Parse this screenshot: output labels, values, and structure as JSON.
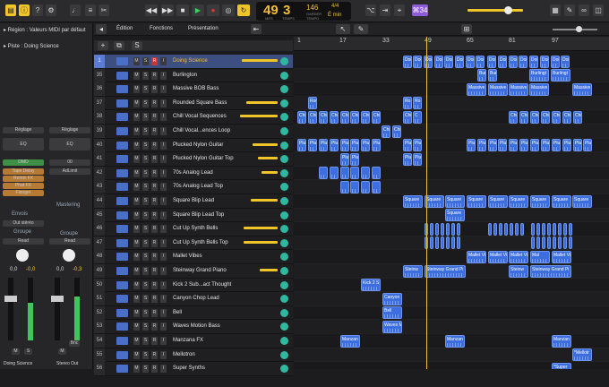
{
  "transport": {
    "bar": "49",
    "beat": "3",
    "bar_lbl": "MES",
    "beat_lbl": "TEMPS",
    "tempo": "146",
    "tempo_lbl": "GARDER",
    "tempo_lbl2": "TEMPO",
    "sig": "4/4",
    "key": "É min",
    "cpu_badge": "⌘34"
  },
  "menus": {
    "edit": "Édition",
    "functions": "Fonctions",
    "presentation": "Présentation"
  },
  "inspector": {
    "region_label": "▸ Région : Valeurs MIDI par défaut",
    "track_label": "▸ Piste : Doing Science",
    "left": {
      "setting": "Réglage",
      "eq": "EQ",
      "midi": "DMD",
      "plugins": [
        "Tape Delay",
        "Remix FX",
        "Phat FX",
        "Flanger"
      ],
      "sends_label": "Envois",
      "send": "Out stéréo",
      "group_label": "Groupe",
      "read": "Read",
      "pan": "0,0",
      "vol": "-0,0",
      "m": "M",
      "s": "S",
      "name": "Doing Science"
    },
    "right": {
      "setting": "Réglage",
      "eq": "EQ",
      "input": "00",
      "limit": "AdLimit",
      "master_label": "Mastering",
      "group_label": "Groupe",
      "read": "Read",
      "pan": "0,0",
      "vol": "-0,3",
      "m": "M",
      "bnc": "Bnc",
      "name": "Stereo Out"
    }
  },
  "ruler": [
    "1",
    "17",
    "33",
    "49",
    "65",
    "81",
    "97"
  ],
  "tracks": [
    {
      "n": "1",
      "name": "Doing Science",
      "fader": 40
    },
    {
      "n": "35",
      "name": "Burlington",
      "fader": 0
    },
    {
      "n": "36",
      "name": "Massive BOB Bass",
      "fader": 0
    },
    {
      "n": "37",
      "name": "Rounded Square Bass",
      "fader": 35
    },
    {
      "n": "38",
      "name": "Chill Vocal Sequences",
      "fader": 42
    },
    {
      "n": "39",
      "name": "Chill Vocal...ences Loop",
      "fader": 0
    },
    {
      "n": "40",
      "name": "Plucked Nylon Guitar",
      "fader": 28
    },
    {
      "n": "41",
      "name": "Plucked Nylon Guitar Top",
      "fader": 22
    },
    {
      "n": "42",
      "name": "70s Analog Lead",
      "fader": 18
    },
    {
      "n": "43",
      "name": "70s Analog Lead Top",
      "fader": 0
    },
    {
      "n": "44",
      "name": "Square Blip Lead",
      "fader": 30
    },
    {
      "n": "45",
      "name": "Square Blip Lead Top",
      "fader": 0
    },
    {
      "n": "46",
      "name": "Cut Up Synth Bells",
      "fader": 38
    },
    {
      "n": "47",
      "name": "Cut Up Synth Bells Top",
      "fader": 38
    },
    {
      "n": "48",
      "name": "Mallet Vibes",
      "fader": 0
    },
    {
      "n": "49",
      "name": "Steinway Grand Piano",
      "fader": 20
    },
    {
      "n": "50",
      "name": "Kick 2 Sub...act Thought",
      "fader": 0
    },
    {
      "n": "51",
      "name": "Canyon Chop Lead",
      "fader": 0
    },
    {
      "n": "52",
      "name": "Bell",
      "fader": 0
    },
    {
      "n": "53",
      "name": "Waves Motion Bass",
      "fader": 0
    },
    {
      "n": "54",
      "name": "Manzana FX",
      "fader": 0
    },
    {
      "n": "55",
      "name": "Mellotron",
      "fader": 0
    },
    {
      "n": "56",
      "name": "Super Synths",
      "fader": 0
    }
  ],
  "regions": [
    {
      "t": 0,
      "x": [
        [
          122,
          10,
          "Doi"
        ],
        [
          133,
          10,
          "Doi"
        ],
        [
          145,
          10,
          "Doi"
        ],
        [
          157,
          10,
          "Doi"
        ],
        [
          168,
          10,
          "Doi"
        ],
        [
          180,
          10,
          "Doi"
        ],
        [
          192,
          10,
          "Doi"
        ],
        [
          203,
          10,
          "Doi"
        ],
        [
          216,
          10,
          "Doi"
        ],
        [
          228,
          10,
          "Doi"
        ],
        [
          240,
          10,
          "Doi"
        ],
        [
          251,
          10,
          "Doi"
        ],
        [
          263,
          10,
          "Doi"
        ],
        [
          275,
          10,
          "Doi"
        ],
        [
          287,
          10,
          "Doi"
        ],
        [
          298,
          10,
          "Doi"
        ]
      ]
    },
    {
      "t": 1,
      "x": [
        [
          205,
          10,
          "Bur"
        ],
        [
          217,
          10,
          "Bur"
        ],
        [
          263,
          22,
          "Burlingt"
        ],
        [
          287,
          22,
          "Burlingt"
        ]
      ]
    },
    {
      "t": 2,
      "x": [
        [
          193,
          22,
          "Massive"
        ],
        [
          217,
          22,
          "Massive"
        ],
        [
          240,
          22,
          "Massive"
        ],
        [
          263,
          22,
          "Massive"
        ],
        [
          311,
          22,
          "Massive"
        ]
      ]
    },
    {
      "t": 3,
      "x": [
        [
          16,
          10,
          "Rou"
        ],
        [
          122,
          10,
          "Ro"
        ],
        [
          133,
          10,
          "Ro"
        ]
      ]
    },
    {
      "t": 4,
      "x": [
        [
          4,
          10,
          "Chi"
        ],
        [
          16,
          10,
          "Chi"
        ],
        [
          28,
          10,
          "Chi"
        ],
        [
          40,
          10,
          "Chi"
        ],
        [
          52,
          10,
          "Chi"
        ],
        [
          63,
          10,
          "Chi"
        ],
        [
          75,
          10,
          "Chi"
        ],
        [
          87,
          10,
          "Chi"
        ],
        [
          122,
          10,
          "Chi"
        ],
        [
          133,
          10,
          "C"
        ],
        [
          240,
          10,
          "Chi"
        ],
        [
          252,
          10,
          "Chi"
        ],
        [
          264,
          10,
          "Chi"
        ],
        [
          276,
          10,
          "Chi"
        ],
        [
          288,
          10,
          "Chi"
        ],
        [
          300,
          10,
          "Chi"
        ],
        [
          312,
          10,
          "Chi"
        ]
      ]
    },
    {
      "t": 5,
      "x": [
        [
          98,
          10,
          "Chi"
        ],
        [
          110,
          10,
          "Chi"
        ]
      ]
    },
    {
      "t": 6,
      "x": [
        [
          4,
          10,
          "Plu"
        ],
        [
          16,
          10,
          "Plu"
        ],
        [
          28,
          10,
          "Plu"
        ],
        [
          40,
          10,
          "Plu"
        ],
        [
          52,
          10,
          "Plu"
        ],
        [
          63,
          10,
          "Plu"
        ],
        [
          75,
          10,
          "Plu"
        ],
        [
          87,
          10,
          "Plu"
        ],
        [
          122,
          10,
          "Plu"
        ],
        [
          133,
          10,
          "Plu"
        ],
        [
          193,
          10,
          "Plu"
        ],
        [
          205,
          10,
          "Plu"
        ],
        [
          217,
          10,
          "Plu"
        ],
        [
          228,
          10,
          "Plu"
        ],
        [
          240,
          10,
          "Plu"
        ],
        [
          252,
          10,
          "Plu"
        ],
        [
          264,
          10,
          "Plu"
        ],
        [
          276,
          10,
          "Plu"
        ],
        [
          288,
          10,
          "Plu"
        ],
        [
          300,
          10,
          "Plu"
        ],
        [
          312,
          10,
          "Plu"
        ],
        [
          323,
          10,
          "Plu"
        ]
      ]
    },
    {
      "t": 7,
      "x": [
        [
          52,
          10,
          "Plu"
        ],
        [
          63,
          10,
          "Plu"
        ],
        [
          122,
          10,
          "Plu"
        ],
        [
          133,
          10,
          "Plu"
        ]
      ]
    },
    {
      "t": 8,
      "x": [
        [
          28,
          10,
          ""
        ],
        [
          40,
          10,
          ""
        ],
        [
          52,
          10,
          ""
        ],
        [
          63,
          10,
          ""
        ],
        [
          75,
          10,
          ""
        ],
        [
          87,
          10,
          ""
        ]
      ]
    },
    {
      "t": 9,
      "x": [
        [
          52,
          10,
          ""
        ],
        [
          63,
          10,
          ""
        ],
        [
          75,
          10,
          ""
        ],
        [
          87,
          10,
          ""
        ]
      ]
    },
    {
      "t": 10,
      "x": [
        [
          122,
          22,
          "Square"
        ],
        [
          146,
          22,
          "Square"
        ],
        [
          169,
          22,
          "Square"
        ],
        [
          193,
          22,
          "Square"
        ],
        [
          217,
          22,
          "Square"
        ],
        [
          240,
          22,
          "Square"
        ],
        [
          264,
          22,
          "Square"
        ],
        [
          288,
          22,
          "Square"
        ],
        [
          311,
          22,
          "Square"
        ]
      ]
    },
    {
      "t": 11,
      "x": [
        [
          169,
          22,
          "Square"
        ]
      ]
    },
    {
      "t": 12,
      "x": [
        [
          146,
          4,
          ""
        ],
        [
          152,
          4,
          ""
        ],
        [
          158,
          4,
          ""
        ],
        [
          164,
          4,
          ""
        ],
        [
          170,
          4,
          ""
        ],
        [
          176,
          4,
          ""
        ],
        [
          182,
          4,
          ""
        ],
        [
          217,
          4,
          ""
        ],
        [
          223,
          4,
          ""
        ],
        [
          229,
          4,
          ""
        ],
        [
          235,
          4,
          ""
        ],
        [
          241,
          4,
          ""
        ],
        [
          247,
          4,
          ""
        ],
        [
          253,
          4,
          ""
        ],
        [
          265,
          4,
          ""
        ],
        [
          271,
          4,
          ""
        ],
        [
          277,
          4,
          ""
        ],
        [
          283,
          4,
          ""
        ],
        [
          289,
          4,
          ""
        ],
        [
          295,
          4,
          ""
        ],
        [
          301,
          4,
          ""
        ],
        [
          307,
          4,
          ""
        ]
      ]
    },
    {
      "t": 13,
      "x": [
        [
          146,
          4,
          ""
        ],
        [
          152,
          4,
          ""
        ],
        [
          158,
          4,
          ""
        ],
        [
          164,
          4,
          ""
        ],
        [
          170,
          4,
          ""
        ],
        [
          176,
          4,
          ""
        ],
        [
          182,
          4,
          ""
        ],
        [
          265,
          4,
          ""
        ],
        [
          271,
          4,
          ""
        ],
        [
          277,
          4,
          ""
        ],
        [
          283,
          4,
          ""
        ],
        [
          289,
          4,
          ""
        ],
        [
          295,
          4,
          ""
        ],
        [
          301,
          4,
          ""
        ],
        [
          307,
          4,
          ""
        ]
      ]
    },
    {
      "t": 14,
      "x": [
        [
          193,
          22,
          "Mallet Vi"
        ],
        [
          217,
          22,
          "Mallet Vi"
        ],
        [
          240,
          22,
          "Mallet Vi"
        ],
        [
          264,
          22,
          "Mal"
        ],
        [
          288,
          22,
          "Mallet Vi"
        ]
      ]
    },
    {
      "t": 15,
      "x": [
        [
          122,
          22,
          "Steinw"
        ],
        [
          146,
          46,
          "Steinway Grand Pi"
        ],
        [
          240,
          22,
          "Steinw"
        ],
        [
          264,
          46,
          "Steinway Grand Pi"
        ]
      ]
    },
    {
      "t": 16,
      "x": [
        [
          75,
          22,
          "Kick 2 S"
        ]
      ]
    },
    {
      "t": 17,
      "x": [
        [
          99,
          22,
          "Canyon"
        ]
      ]
    },
    {
      "t": 18,
      "x": [
        [
          99,
          22,
          "Bell"
        ]
      ]
    },
    {
      "t": 19,
      "x": [
        [
          99,
          22,
          "Waves M"
        ]
      ]
    },
    {
      "t": 20,
      "x": [
        [
          52,
          22,
          "Manzan"
        ],
        [
          169,
          22,
          "Manzan"
        ],
        [
          288,
          22,
          "Manzan"
        ]
      ]
    },
    {
      "t": 21,
      "x": [
        [
          311,
          22,
          "*Mellotr"
        ]
      ]
    },
    {
      "t": 22,
      "x": [
        [
          288,
          22,
          "*Super"
        ]
      ]
    }
  ]
}
